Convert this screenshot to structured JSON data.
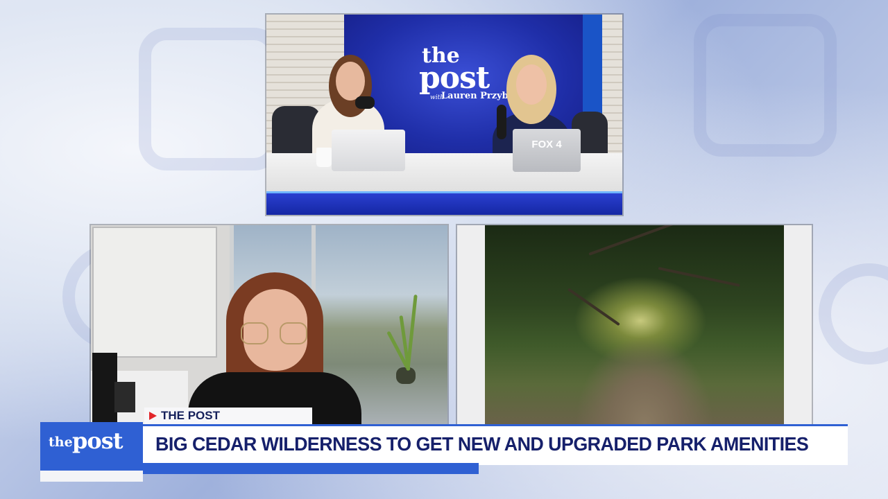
{
  "studio": {
    "logo_the": "the",
    "logo_post": "post",
    "logo_with": "with",
    "logo_host": "Lauren Przybyl",
    "laptop_label": "FOX 4"
  },
  "lower_third": {
    "bug_the": "the",
    "bug_post": "post",
    "show_tag": "THE POST",
    "headline": "BIG CEDAR WILDERNESS TO GET NEW AND UPGRADED PARK AMENITIES"
  },
  "colors": {
    "brand_blue": "#2f60d3",
    "headline_navy": "#16206b",
    "tag_red": "#e2262b"
  }
}
